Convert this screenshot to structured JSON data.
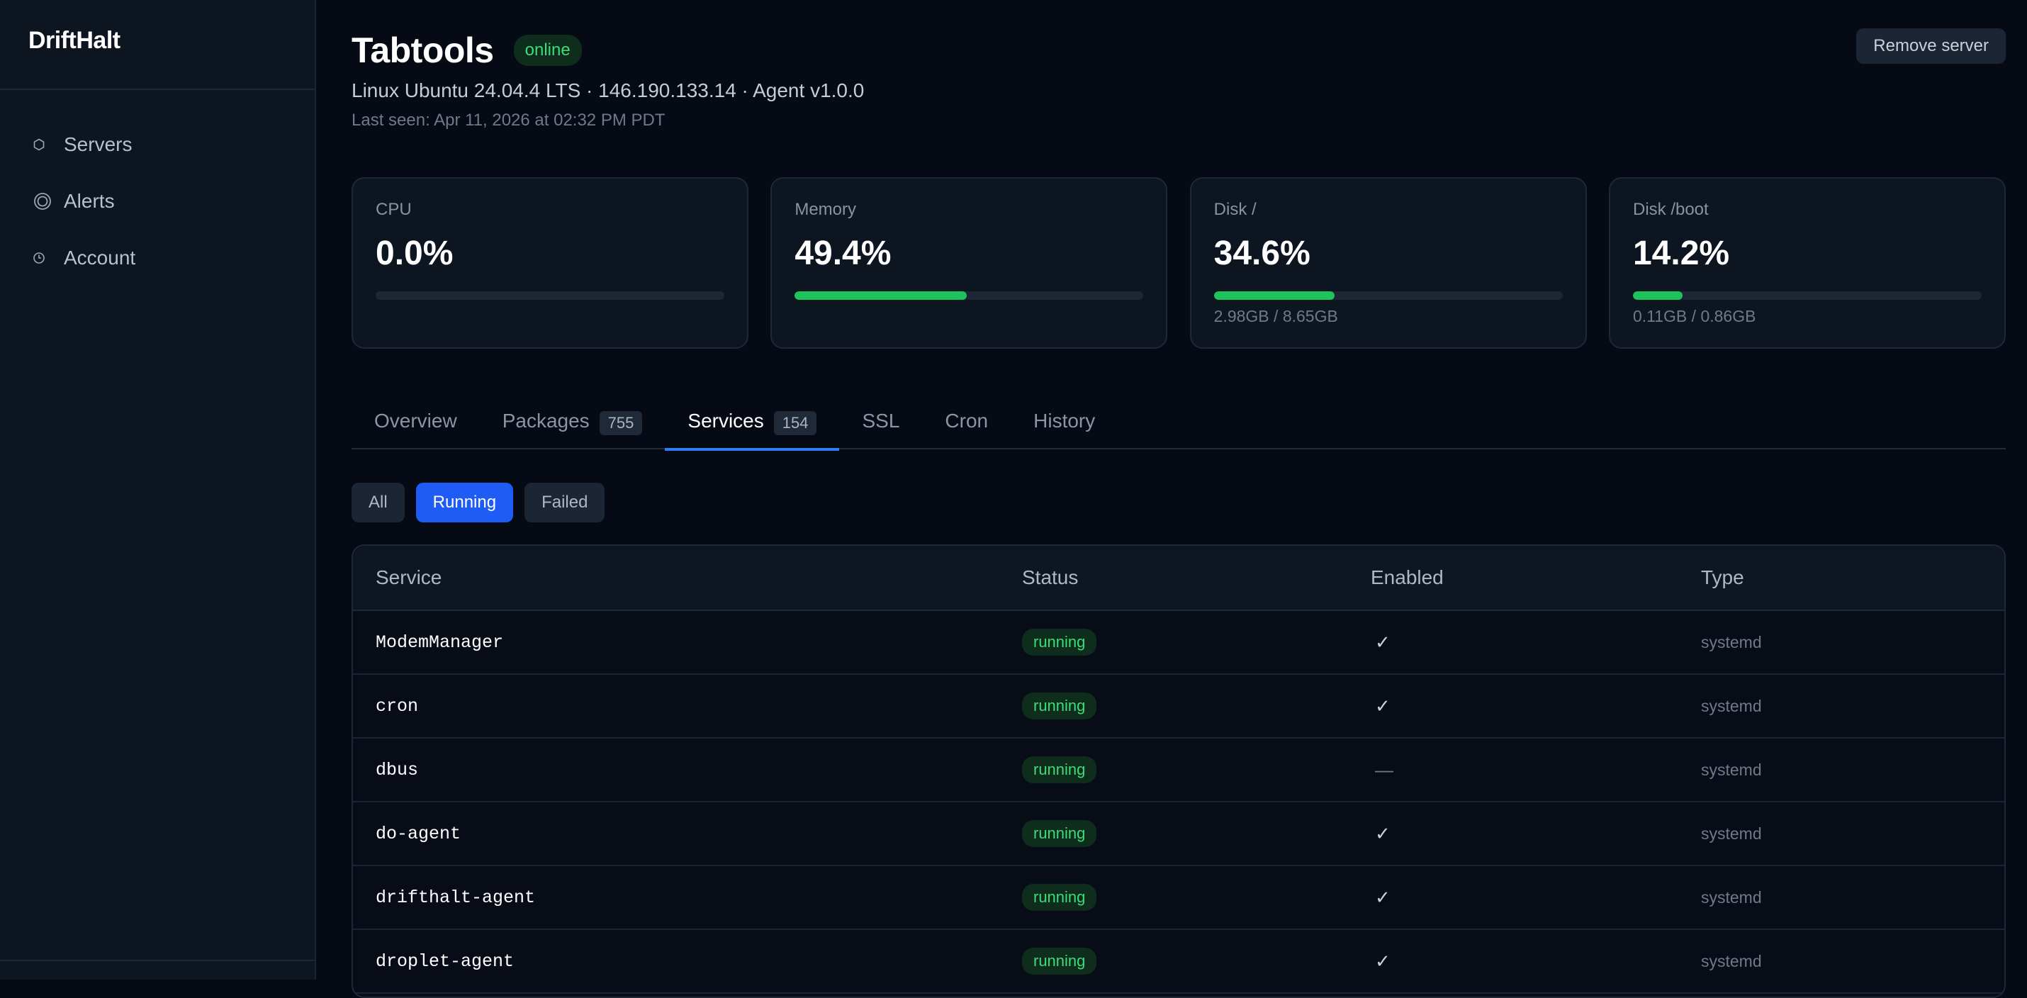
{
  "sidebar": {
    "brand": "DriftHalt",
    "items": [
      {
        "label": "Servers",
        "icon": "hexagon-icon"
      },
      {
        "label": "Alerts",
        "icon": "bell-ring-icon"
      },
      {
        "label": "Account",
        "icon": "clock-user-icon"
      }
    ]
  },
  "header": {
    "title": "Tabtools",
    "status_badge": "online",
    "subline": "Linux Ubuntu 24.04.4 LTS · 146.190.133.14 · Agent v1.0.0",
    "last_seen": "Last seen: Apr 11, 2026 at 02:32 PM PDT",
    "remove_button": "Remove server"
  },
  "metrics": [
    {
      "label": "CPU",
      "value": "0.0%",
      "fraction": 0.0,
      "detail": ""
    },
    {
      "label": "Memory",
      "value": "49.4%",
      "fraction": 0.494,
      "detail": ""
    },
    {
      "label": "Disk /",
      "value": "34.6%",
      "fraction": 0.346,
      "detail": "2.98GB / 8.65GB"
    },
    {
      "label": "Disk /boot",
      "value": "14.2%",
      "fraction": 0.142,
      "detail": "0.11GB / 0.86GB"
    }
  ],
  "tabs": [
    {
      "label": "Overview",
      "count": ""
    },
    {
      "label": "Packages",
      "count": "755"
    },
    {
      "label": "Services",
      "count": "154",
      "active": true
    },
    {
      "label": "SSL",
      "count": ""
    },
    {
      "label": "Cron",
      "count": ""
    },
    {
      "label": "History",
      "count": ""
    }
  ],
  "filters": [
    {
      "label": "All",
      "active": false
    },
    {
      "label": "Running",
      "active": true
    },
    {
      "label": "Failed",
      "active": false
    }
  ],
  "table": {
    "columns": [
      "Service",
      "Status",
      "Enabled",
      "Type"
    ],
    "rows": [
      {
        "service": "ModemManager",
        "status": "running",
        "enabled": "✓",
        "type": "systemd"
      },
      {
        "service": "cron",
        "status": "running",
        "enabled": "✓",
        "type": "systemd"
      },
      {
        "service": "dbus",
        "status": "running",
        "enabled": "—",
        "type": "systemd"
      },
      {
        "service": "do-agent",
        "status": "running",
        "enabled": "✓",
        "type": "systemd"
      },
      {
        "service": "drifthalt-agent",
        "status": "running",
        "enabled": "✓",
        "type": "systemd"
      },
      {
        "service": "droplet-agent",
        "status": "running",
        "enabled": "✓",
        "type": "systemd"
      }
    ]
  },
  "colors": {
    "accent": "#1f5cf5",
    "success": "#3ddc78",
    "bar_fill": "#1fc35b",
    "background": "#050a14"
  }
}
